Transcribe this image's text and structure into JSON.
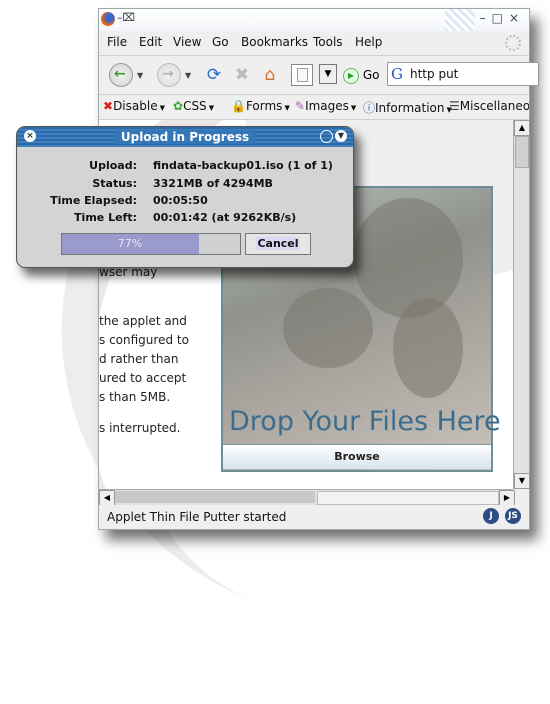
{
  "browser": {
    "menu": [
      "File",
      "Edit",
      "View",
      "Go",
      "Bookmarks",
      "Tools",
      "Help"
    ],
    "search_value": "http put",
    "go_label": "Go",
    "dev_toolbar": [
      "Disable",
      "CSS",
      "Forms",
      "Images",
      "Information",
      "Miscellaneo"
    ],
    "status_text": "Applet Thin File Putter started",
    "status_icons": [
      "J",
      "JS"
    ]
  },
  "page": {
    "text_lines": [
      "wser may",
      "the applet and",
      "s configured to",
      "d rather than",
      "ured to accept",
      "s than 5MB.",
      "s interrupted."
    ],
    "applet": {
      "drop_text": "Drop Your Files Here",
      "browse_label": "Browse"
    }
  },
  "dialog": {
    "title": "Upload in Progress",
    "rows": [
      {
        "label": "Upload:",
        "value": "findata-backup01.iso (1 of 1)"
      },
      {
        "label": "Status:",
        "value": "3321MB of 4294MB"
      },
      {
        "label": "Time Elapsed:",
        "value": "00:05:50"
      },
      {
        "label": "Time Left:",
        "value": "00:01:42 (at 9262KB/s)"
      }
    ],
    "progress_percent": 77,
    "progress_label": "77%",
    "cancel_label": "Cancel",
    "colors": {
      "title_bar": "#3577b6",
      "progress_fill": "#9a9acd"
    }
  }
}
